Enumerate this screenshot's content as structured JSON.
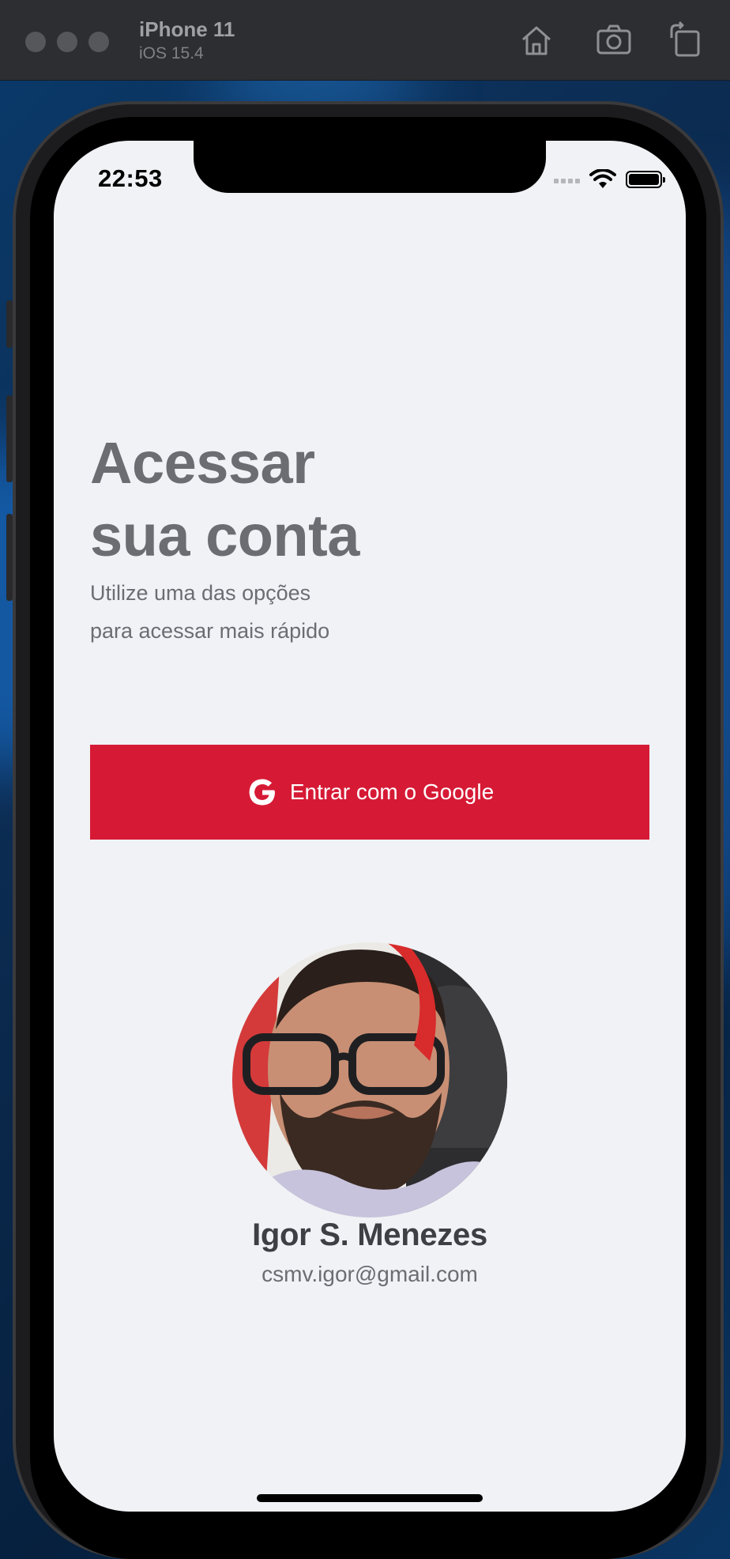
{
  "simulator": {
    "device_name": "iPhone 11",
    "os_version": "iOS 15.4",
    "toolbar_icons": [
      "home-icon",
      "screenshot-icon",
      "rotate-icon"
    ]
  },
  "status_bar": {
    "time": "22:53",
    "icons": [
      "cellular-signal-icon",
      "wifi-icon",
      "battery-icon"
    ]
  },
  "login": {
    "title_line1": "Acessar",
    "title_line2": "sua conta",
    "subtitle_line1": "Utilize uma das opções",
    "subtitle_line2": "para acessar mais rápido",
    "google_button_label": "Entrar com o Google",
    "google_button_color": "#d61a35"
  },
  "user": {
    "name": "Igor S. Menezes",
    "email": "csmv.igor@gmail.com"
  }
}
